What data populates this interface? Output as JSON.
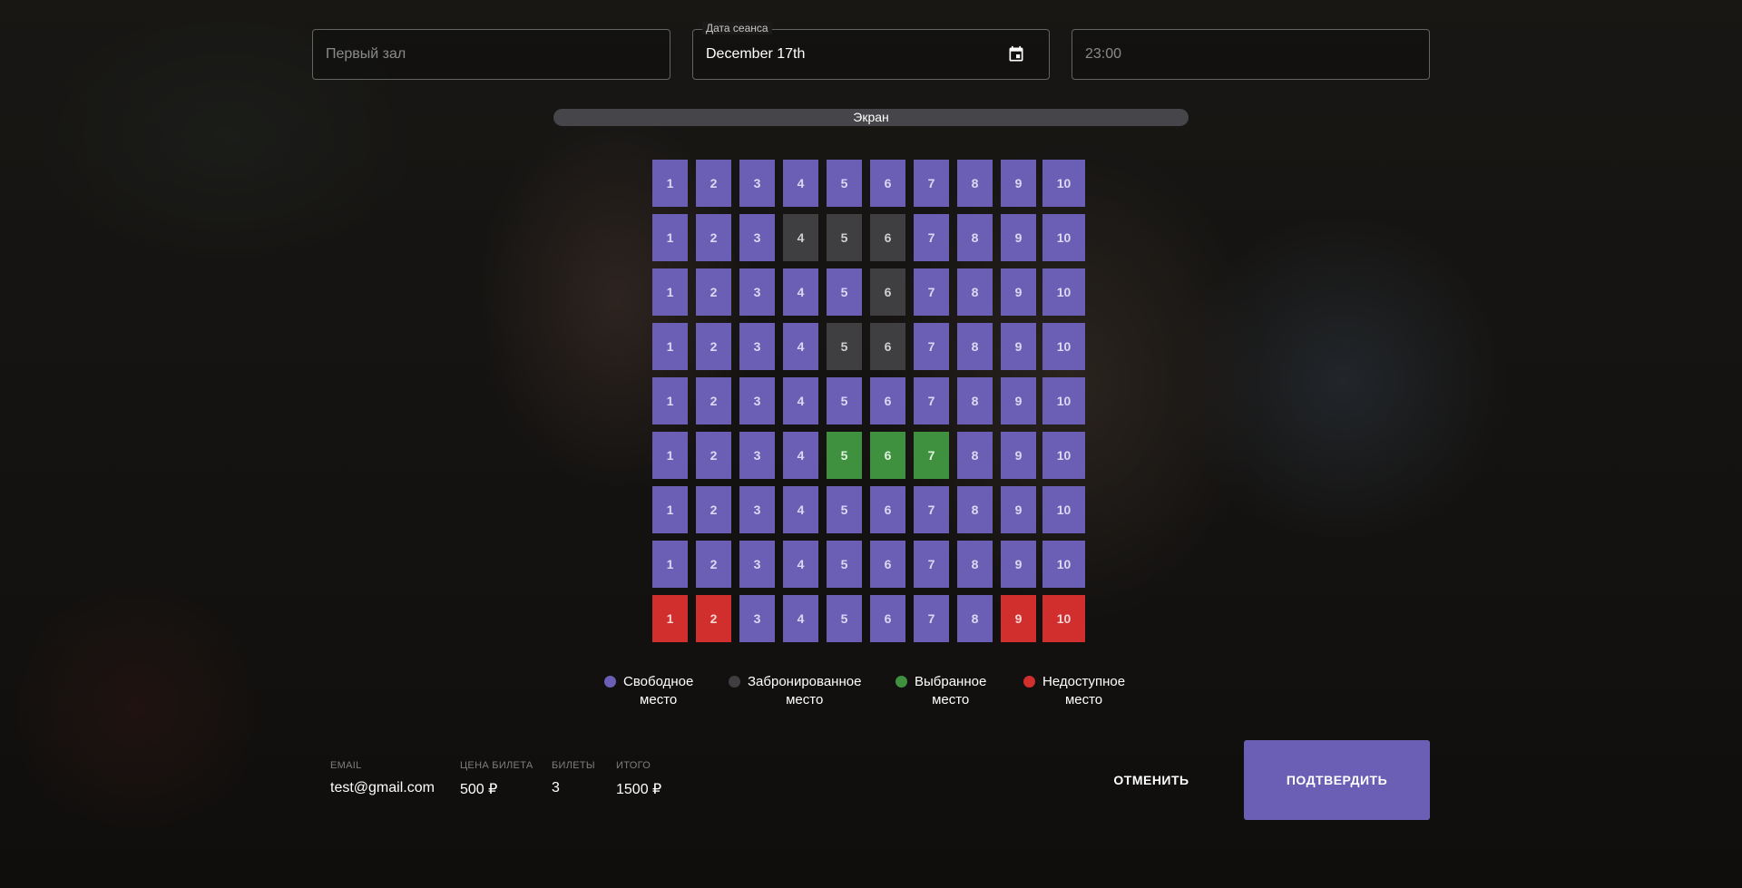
{
  "form": {
    "hall_placeholder": "Первый зал",
    "date_label": "Дата сеанса",
    "date_value": "December 17th",
    "date_icon": "calendar-icon",
    "time_placeholder": "23:00"
  },
  "screen": {
    "label": "Экран"
  },
  "seat_colors": {
    "free": "#6a5fb4",
    "booked": "#3f3f41",
    "selected": "#3f913f",
    "unavailable": "#d12e2e"
  },
  "seats": [
    [
      "free",
      "free",
      "free",
      "free",
      "free",
      "free",
      "free",
      "free",
      "free",
      "free"
    ],
    [
      "free",
      "free",
      "free",
      "booked",
      "booked",
      "booked",
      "free",
      "free",
      "free",
      "free"
    ],
    [
      "free",
      "free",
      "free",
      "free",
      "free",
      "booked",
      "free",
      "free",
      "free",
      "free"
    ],
    [
      "free",
      "free",
      "free",
      "free",
      "booked",
      "booked",
      "free",
      "free",
      "free",
      "free"
    ],
    [
      "free",
      "free",
      "free",
      "free",
      "free",
      "free",
      "free",
      "free",
      "free",
      "free"
    ],
    [
      "free",
      "free",
      "free",
      "free",
      "selected",
      "selected",
      "selected",
      "free",
      "free",
      "free"
    ],
    [
      "free",
      "free",
      "free",
      "free",
      "free",
      "free",
      "free",
      "free",
      "free",
      "free"
    ],
    [
      "free",
      "free",
      "free",
      "free",
      "free",
      "free",
      "free",
      "free",
      "free",
      "free"
    ],
    [
      "unavailable",
      "unavailable",
      "free",
      "free",
      "free",
      "free",
      "free",
      "free",
      "unavailable",
      "unavailable"
    ]
  ],
  "seat_numbers": [
    "1",
    "2",
    "3",
    "4",
    "5",
    "6",
    "7",
    "8",
    "9",
    "10"
  ],
  "legend": {
    "free": [
      "Свободное",
      "место"
    ],
    "booked": [
      "Забронированное",
      "место"
    ],
    "selected": [
      "Выбранное",
      "место"
    ],
    "unavailable": [
      "Недоступное",
      "место"
    ]
  },
  "summary": {
    "email_label": "EMAIL",
    "email_value": "test@gmail.com",
    "price_label": "ЦЕНА БИЛЕТА",
    "price_value": "500 ₽",
    "tickets_label": "БИЛЕТЫ",
    "tickets_value": "3",
    "total_label": "ИТОГО",
    "total_value": "1500 ₽"
  },
  "actions": {
    "cancel_label": "ОТМЕНИТЬ",
    "confirm_label": "ПОДТВЕРДИТЬ"
  }
}
